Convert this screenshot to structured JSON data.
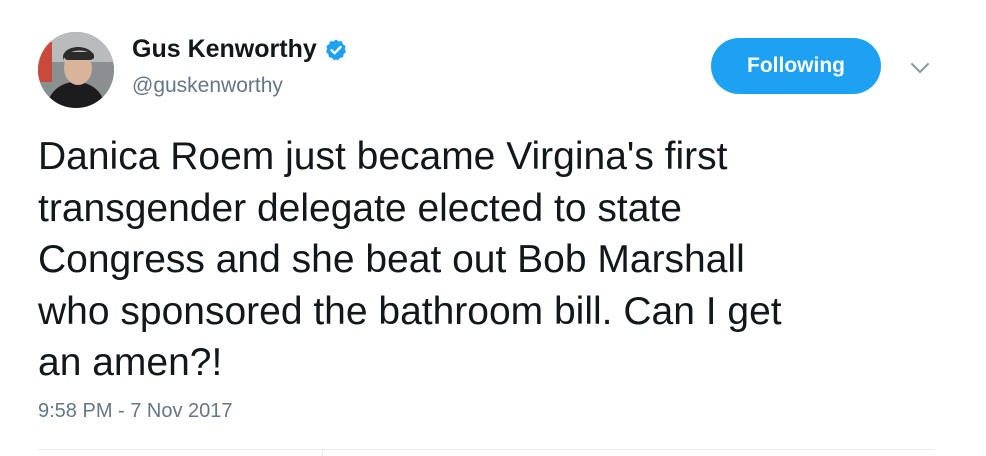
{
  "tweet": {
    "author": {
      "display_name": "Gus Kenworthy",
      "handle": "@guskenworthy",
      "verified": true,
      "avatar_icon": "profile-photo"
    },
    "follow_button_label": "Following",
    "more_options_icon": "chevron-down-icon",
    "text_lines": [
      "Danica Roem just became Virgina's first",
      "transgender delegate elected to state",
      "Congress and she beat out Bob Marshall",
      "who sponsored the bathroom bill. Can I get",
      "an amen?!"
    ],
    "timestamp": "9:58 PM - 7 Nov 2017"
  },
  "colors": {
    "accent": "#1da1f2",
    "text_primary": "#14171a",
    "text_secondary": "#657786",
    "divider": "#e6ecf0"
  }
}
